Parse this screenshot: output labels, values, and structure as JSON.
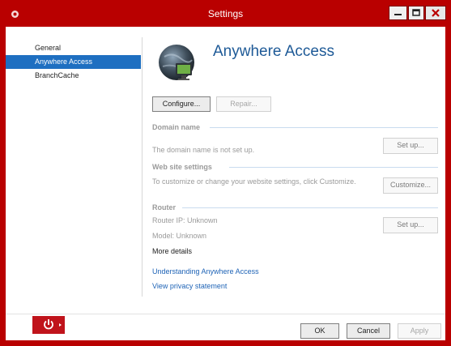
{
  "window": {
    "title": "Settings",
    "accent": "#b90000"
  },
  "sidebar": {
    "items": [
      {
        "label": "General",
        "active": false
      },
      {
        "label": "Anywhere Access",
        "active": true
      },
      {
        "label": "BranchCache",
        "active": false
      }
    ]
  },
  "main": {
    "title": "Anywhere Access",
    "configure_label": "Configure...",
    "repair_label": "Repair...",
    "domain": {
      "heading": "Domain name",
      "status": "The domain name is not set up.",
      "setup_label": "Set up..."
    },
    "website": {
      "heading": "Web site settings",
      "description": "To customize or change your website settings, click Customize.",
      "customize_label": "Customize..."
    },
    "router": {
      "heading": "Router",
      "ip": "Router IP: Unknown",
      "model": "Model: Unknown",
      "more": "More details",
      "setup_label": "Set up..."
    },
    "links": {
      "understanding": "Understanding Anywhere Access",
      "privacy": "View privacy statement"
    }
  },
  "footer": {
    "ok_label": "OK",
    "cancel_label": "Cancel",
    "apply_label": "Apply"
  },
  "icons": {
    "app": "server-icon",
    "power": "power-icon",
    "globe": "globe-computer-icon"
  }
}
